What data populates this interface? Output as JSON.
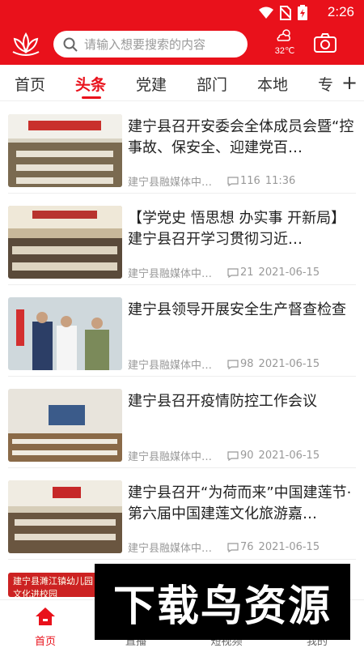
{
  "status": {
    "time": "2:26",
    "icons": [
      "wifi-icon",
      "no-sim-icon",
      "battery-charging-icon"
    ]
  },
  "header": {
    "search_placeholder": "请输入想要搜索的内容",
    "weather_temp": "32℃",
    "colors": {
      "brand": "#e9111b"
    }
  },
  "tabs": [
    {
      "label": "首页",
      "active": false
    },
    {
      "label": "头条",
      "active": true
    },
    {
      "label": "党建",
      "active": false
    },
    {
      "label": "部门",
      "active": false
    },
    {
      "label": "本地",
      "active": false
    },
    {
      "label": "专",
      "active": false
    }
  ],
  "news": [
    {
      "title": "建宁县召开安委会全体成员会暨“控事故、保安全、迎建党百…",
      "source": "建宁县融媒体中…",
      "comments": "116",
      "time": "11:36"
    },
    {
      "title": "【学党史 悟思想 办实事 开新局】建宁县召开学习贯彻习近…",
      "source": "建宁县融媒体中…",
      "comments": "21",
      "time": "2021-06-15"
    },
    {
      "title": "建宁县领导开展安全生产督查检查",
      "source": "建宁县融媒体中…",
      "comments": "98",
      "time": "2021-06-15"
    },
    {
      "title": "建宁县召开疫情防控工作会议",
      "source": "建宁县融媒体中…",
      "comments": "90",
      "time": "2021-06-15"
    },
    {
      "title": "建宁县召开“为荷而来”中国建莲节·第六届中国建莲文化旅游嘉…",
      "source": "建宁县融媒体中…",
      "comments": "76",
      "time": "2021-06-15"
    }
  ],
  "partial_item": {
    "thumb_text": "建宁县濉江镇幼儿园 非遗文化进校园"
  },
  "bottom_nav": [
    {
      "label": "首页",
      "icon": "home-icon",
      "active": true
    },
    {
      "label": "直播",
      "icon": "live-icon",
      "active": false
    },
    {
      "label": "短视频",
      "icon": "video-icon",
      "active": false
    },
    {
      "label": "我的",
      "icon": "user-icon",
      "active": false
    }
  ],
  "watermark": "下载鸟资源"
}
